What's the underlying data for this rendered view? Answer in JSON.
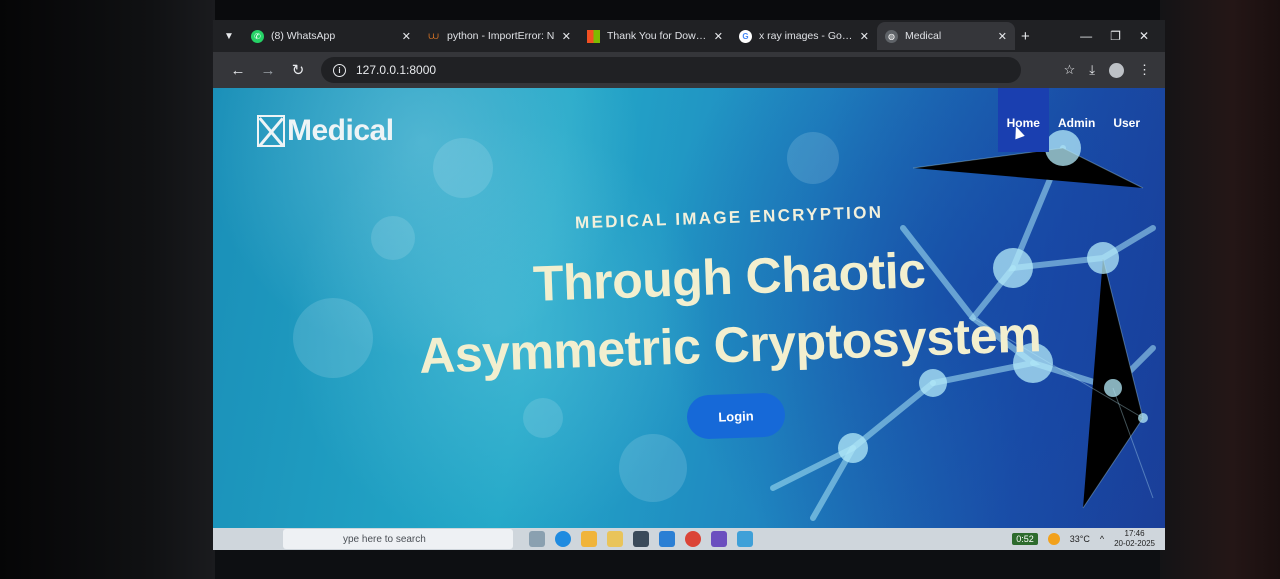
{
  "browser": {
    "tabs": [
      {
        "label": "(8) WhatsApp",
        "icon": "whatsapp-icon",
        "color": "#25d366"
      },
      {
        "label": "python - ImportError: N",
        "icon": "stackoverflow-icon",
        "color": "#f48024"
      },
      {
        "label": "Thank You for Download",
        "icon": "microsoft-icon",
        "color": "#f25022"
      },
      {
        "label": "x ray images - Google S",
        "icon": "google-icon",
        "color": "#4285f4"
      },
      {
        "label": "Medical",
        "icon": "globe-icon",
        "color": "#9aa0a6"
      }
    ],
    "url": "127.0.0.1:8000"
  },
  "site": {
    "brand": "Medical",
    "nav": [
      "Home",
      "Admin",
      "User"
    ],
    "hero_kicker": "MEDICAL IMAGE ENCRYPTION",
    "hero_line1": "Through Chaotic",
    "hero_line2": "Asymmetric Cryptosystem",
    "login_label": "Login"
  },
  "taskbar": {
    "search_placeholder": "ype here to search",
    "battery": "0:52",
    "temperature": "33°C",
    "time": "17:46",
    "date": "20-02-2025"
  }
}
